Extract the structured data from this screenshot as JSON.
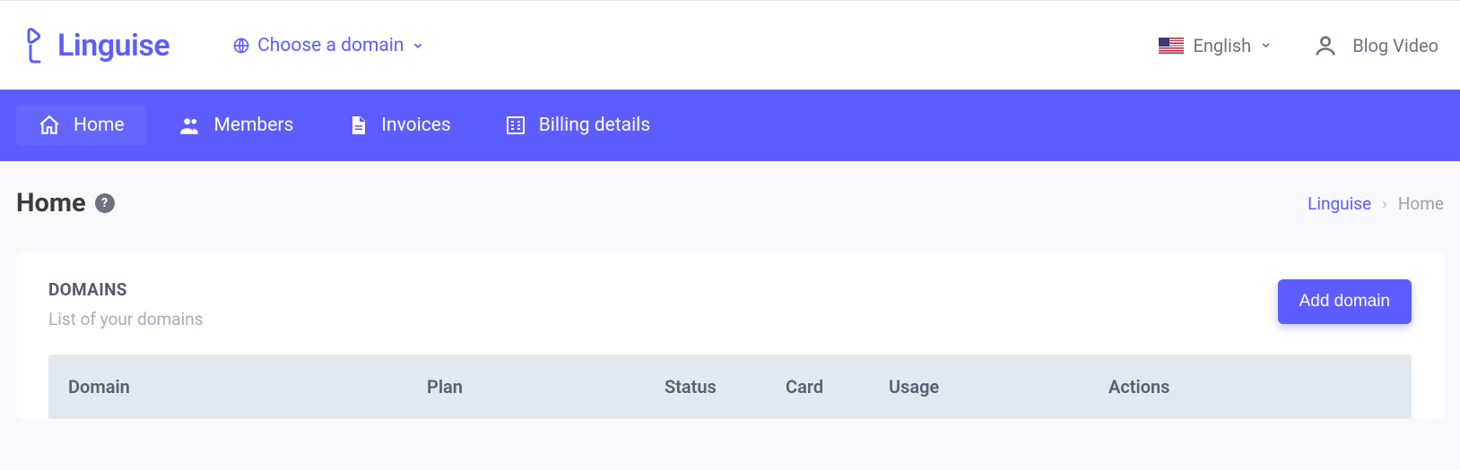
{
  "brand": {
    "name": "Linguise"
  },
  "header": {
    "domain_selector": "Choose a domain",
    "language": "English",
    "user_label": "Blog Video"
  },
  "nav": {
    "items": [
      {
        "label": "Home"
      },
      {
        "label": "Members"
      },
      {
        "label": "Invoices"
      },
      {
        "label": "Billing details"
      }
    ]
  },
  "page": {
    "title": "Home",
    "help_symbol": "?"
  },
  "breadcrumb": {
    "root": "Linguise",
    "separator": "›",
    "current": "Home"
  },
  "domains_card": {
    "title": "DOMAINS",
    "subtitle": "List of your domains",
    "add_button": "Add domain",
    "columns": {
      "domain": "Domain",
      "plan": "Plan",
      "status": "Status",
      "card": "Card",
      "usage": "Usage",
      "actions": "Actions"
    }
  }
}
